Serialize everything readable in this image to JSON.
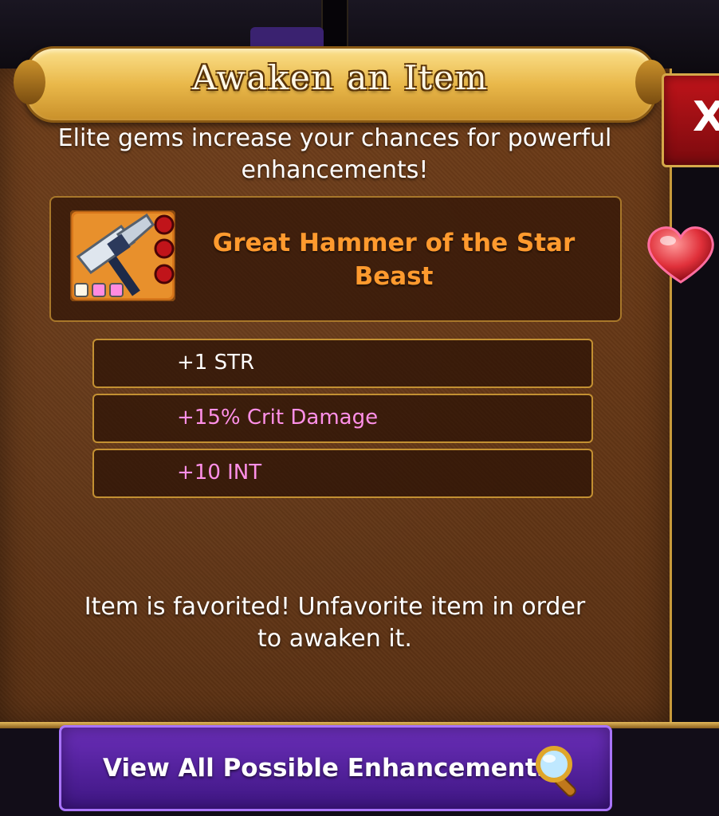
{
  "dialog": {
    "title": "Awaken an Item",
    "subtitle": "Elite gems increase your chances for powerful enhancements!",
    "close_label": "X"
  },
  "item": {
    "name": "Great Hammer of the Star Beast",
    "icon": "hammer-icon",
    "favorited": true,
    "gem_slots": [
      "white",
      "pink",
      "pink"
    ],
    "socket_gems": 3
  },
  "stats": [
    {
      "text": "+1 STR",
      "color": "#ffffff"
    },
    {
      "text": "+15% Crit Damage",
      "color": "#ff90e8"
    },
    {
      "text": "+10 INT",
      "color": "#ff90e8"
    }
  ],
  "notice": "Item is favorited! Unfavorite item in order to awaken it.",
  "footer": {
    "view_button_label": "View All Possible Enhancements",
    "view_button_icon": "magnifying-glass-icon"
  },
  "colors": {
    "panel": "#6d3c18",
    "item_name": "#ff9a2e",
    "enhancement_pink": "#ff90e8",
    "button_purple": "#5a24a0",
    "close_red": "#c0141a"
  }
}
